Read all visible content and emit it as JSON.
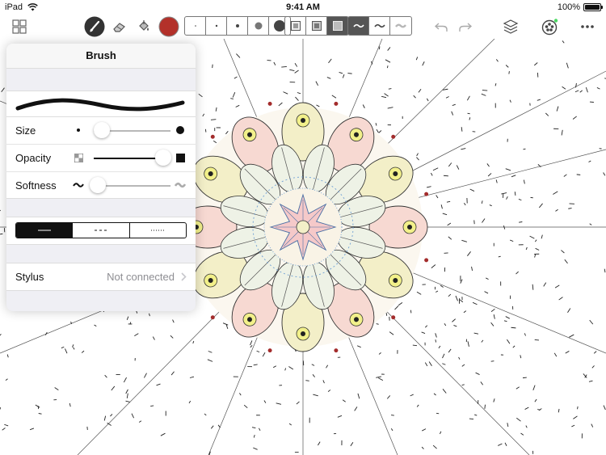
{
  "status_bar": {
    "device": "iPad",
    "time": "9:41 AM",
    "battery": "100%"
  },
  "toolbar": {
    "brush_color": "#b3312a",
    "accent": "#111111",
    "tools": [
      "grid-icon",
      "brush-icon",
      "eraser-icon",
      "fill-bucket-icon"
    ],
    "brush_sizes": 5,
    "selected_size_index": 3,
    "texture_modes": 3,
    "selected_texture_index": 2,
    "stroke_styles": 3,
    "selected_stroke_style_index": 0
  },
  "panel": {
    "title": "Brush",
    "size_label": "Size",
    "size_value": 0.1,
    "opacity_label": "Opacity",
    "opacity_value": 0.9,
    "softness_label": "Softness",
    "softness_value": 0.05,
    "line_styles": [
      "solid",
      "dashed",
      "dotted"
    ],
    "selected_line_style": "solid",
    "stylus_label": "Stylus",
    "stylus_value": "Not connected"
  }
}
